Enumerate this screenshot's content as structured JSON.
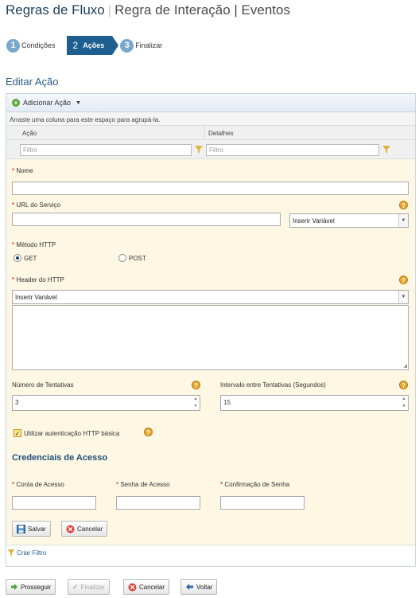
{
  "header": {
    "title_main": "Regras de Fluxo",
    "title_rest": "Regra de Interação | Eventos"
  },
  "steps": [
    {
      "num": "1",
      "label": "Condições"
    },
    {
      "num": "2",
      "label": "Ações"
    },
    {
      "num": "3",
      "label": "Finalizar"
    }
  ],
  "section_title": "Editar Ação",
  "grid": {
    "add_action": "Adicionar Ação",
    "group_hint": "Arraste uma coluna para este espaço para agrupá-la.",
    "columns": [
      "Ação",
      "Detalhes"
    ],
    "filter_placeholder": "Filtro",
    "create_filter": "Criar Filtro"
  },
  "form": {
    "name_label": "Nome",
    "url_label": "URL do Serviço",
    "insert_variable": "Inserir Variável",
    "method_label": "Método HTTP",
    "method_get": "GET",
    "method_post": "POST",
    "header_label": "Header do HTTP",
    "attempts_label": "Número de Tentativas",
    "attempts_value": "3",
    "interval_label": "Intervalo entre Tentativas (Segundos)",
    "interval_value": "15",
    "basic_auth_label": "Utilizar autenticação HTTP básica",
    "credentials_title": "Credenciais de Acesso",
    "account_label": "Conta de Acesso",
    "password_label": "Senha de Acesso",
    "confirm_label": "Confirmação de Senha",
    "save": "Salvar",
    "cancel": "Cancelar"
  },
  "footer": {
    "next": "Prosseguir",
    "finish": "Finalizar",
    "cancel": "Cancelar",
    "back": "Voltar"
  },
  "colors": {
    "title": "#1c3e5c",
    "step_active": "#1e5f8f",
    "form_bg": "#fdf7e4"
  }
}
